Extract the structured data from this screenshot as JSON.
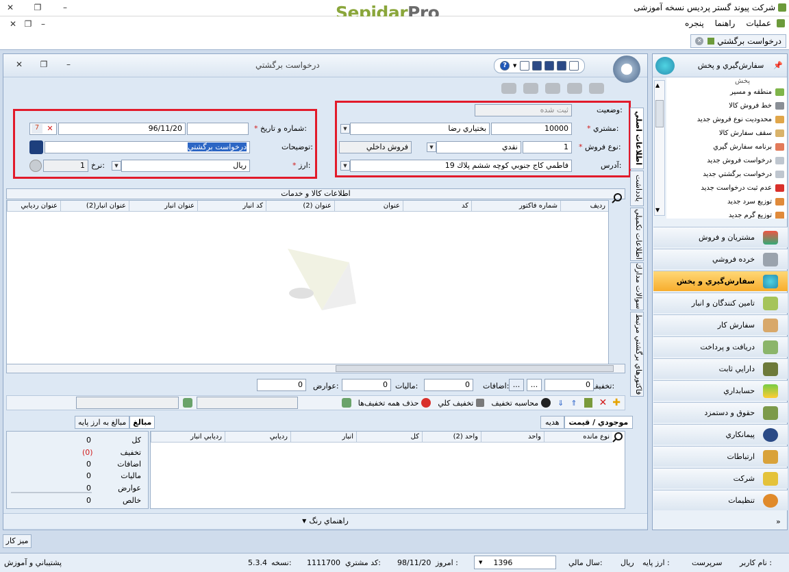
{
  "window": {
    "title": "شرکت پیوند گستر پردیس نسخه آموزشی",
    "logo_main": "Sepidar",
    "logo_suffix": "Pro"
  },
  "menu": {
    "items": [
      "عملیات",
      "راهنما",
      "پنجره"
    ]
  },
  "doc_tab": {
    "label": "درخواست برگشتي"
  },
  "form": {
    "title": "درخواست برگشتي",
    "status_label": "وضعیت:",
    "status_value": "ثبت شده",
    "customer_label": "مشتري:",
    "customer_code": "10000",
    "customer_name": "بختیاري رضا",
    "sale_type_label": "نوع فروش:",
    "sale_type_code": "1",
    "sale_type_payment": "نقدي",
    "sale_type_name": "فروش داخلي",
    "address_label": "آدرس:",
    "address_value": "فاطمي كاج جنوبي كوچه ششم پلاك 19",
    "number_date_label": "شماره و تاريخ:",
    "number_value": "",
    "date_value": "96/11/20",
    "description_label": "توضيحات:",
    "description_value": "درخواست برگشتي",
    "currency_label": "ارز:",
    "currency_value": "ريال",
    "rate_label": "نرخ:",
    "rate_value": "1"
  },
  "vertical_tabs": [
    "اطلاعات اصلي",
    "يادداشت",
    "اطلاعات تکميلي",
    "سوالات مدارك",
    "فاکتورهاي برگشتي مرتبط"
  ],
  "items_grid": {
    "title": "اطلاعات كالا و خدمات",
    "columns": [
      "رديف",
      "شماره فاكتور",
      "كد",
      "عنوان",
      "عنوان (2)",
      "كد انبار",
      "عنوان انبار",
      "عنوان انبار(2)",
      "عنوان رديابي"
    ]
  },
  "totals_row": {
    "discount_label": "تخفيف:",
    "discount_value": "0",
    "additions_label": "اضافات:",
    "additions_value": "0",
    "tax_label": "ماليات:",
    "tax_value": "0",
    "duties_label": "عوارض:",
    "duties_value": "0",
    "more": "..."
  },
  "item_toolbar": {
    "calc_discount": "محاسبه تخفيف",
    "total_discount": "تخفيف كلي",
    "remove_discounts": "حذف همه تخفيف‌ها"
  },
  "bottom_tabs": {
    "stock_price": "موجودي / قيمت",
    "gift": "هديه"
  },
  "stock_grid": {
    "columns": [
      "نوع مانده",
      "واحد",
      "واحد (2)",
      "كل",
      "انبار",
      "رديابي",
      "رديابي انبار"
    ]
  },
  "amount_tabs": {
    "amounts": "مبالغ",
    "base_amounts": "مبالغ به ارز پايه"
  },
  "amounts": [
    {
      "label": "كل",
      "value": "0"
    },
    {
      "label": "تخفيف",
      "value": "(0)"
    },
    {
      "label": "اضافات",
      "value": "0"
    },
    {
      "label": "ماليات",
      "value": "0"
    },
    {
      "label": "عوارض",
      "value": "0"
    },
    {
      "label": "خالص",
      "value": "0"
    }
  ],
  "color_guide": "راهنماي رنگ",
  "side_panel": {
    "header": "سفارش‌گيري و پخش",
    "items_partial": "پخش",
    "items": [
      "منطقه و مسير",
      "خط فروش كالا",
      "محدوديت نوع فروش جديد",
      "سقف سفارش كالا",
      "برنامه سفارش گيري",
      "درخواست فروش جديد",
      "درخواست برگشتي جديد",
      "عدم ثبت درخواست جديد",
      "توزيع سرد جديد",
      "توزيع گرم جديد"
    ],
    "nav": [
      "مشتريان و فروش",
      "خرده فروشي",
      "سفارش‌گيري و پخش",
      "تامين كنندگان و انبار",
      "سفارش كار",
      "دريافت و پرداخت",
      "دارايي ثابت",
      "حسابداري",
      "حقوق و دستمزد",
      "پيمانكاري",
      "ارتباطات",
      "شركت",
      "تنظيمات"
    ]
  },
  "desktop_button": "ميز كار",
  "statusbar": {
    "user_label": "نام کاربر :",
    "user_value": "سرپرست",
    "base_currency_label": "ارز پايه :",
    "base_currency_value": "ريال",
    "fiscal_year_label": "سال مالي:",
    "fiscal_year_value": "1396",
    "today_label": "امروز :",
    "today_value": "98/11/20",
    "customer_code_label": "كد مشتري:",
    "customer_code_value": "1111700",
    "version_label": "نسخه:",
    "version_value": "5.3.4",
    "support": "پشتيباني و آموزش"
  },
  "colors": {
    "accent_red": "#e21a2a",
    "active_nav": "#f7ad2d",
    "logo_green": "#8aa63b"
  }
}
